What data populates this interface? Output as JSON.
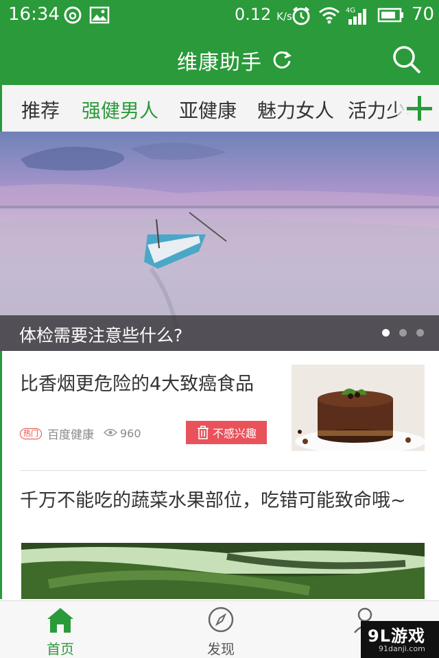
{
  "status_bar": {
    "time": "16:34",
    "speed": "0.12",
    "speed_unit": "K/s",
    "battery": "70",
    "icons": [
      "netease-music-icon",
      "image-icon",
      "alarm-icon",
      "wifi-icon",
      "4g-signal-icon",
      "battery-icon"
    ]
  },
  "app_bar": {
    "title": "维康助手",
    "refresh_icon": "refresh-icon",
    "search_icon": "search-icon"
  },
  "tabs": {
    "items": [
      "推荐",
      "强健男人",
      "亚健康",
      "魅力女人",
      "活力少年"
    ],
    "active_index": 1,
    "add_icon": "plus-icon"
  },
  "banner": {
    "caption": "体检需要注意些什么?",
    "slide_count": 3,
    "active_slide": 0
  },
  "feed": {
    "articles": [
      {
        "title": "比香烟更危险的4大致癌食品",
        "badge": "热门",
        "source": "百度健康",
        "views": "960",
        "dislike_label": "不感兴趣"
      },
      {
        "title": "千万不能吃的蔬菜水果部位，吃错可能致命哦~"
      }
    ]
  },
  "bottom_nav": {
    "items": [
      {
        "label": "首页",
        "icon": "home-icon"
      },
      {
        "label": "发现",
        "icon": "compass-icon"
      },
      {
        "label": "",
        "icon": "profile-icon"
      }
    ],
    "active_index": 0
  },
  "watermark": {
    "brand": "9L游戏",
    "domain": "91danji.com"
  },
  "colors": {
    "primary_green": "#2a9a3a",
    "dislike_red": "#e9525a",
    "hot_red": "#e8453c"
  }
}
